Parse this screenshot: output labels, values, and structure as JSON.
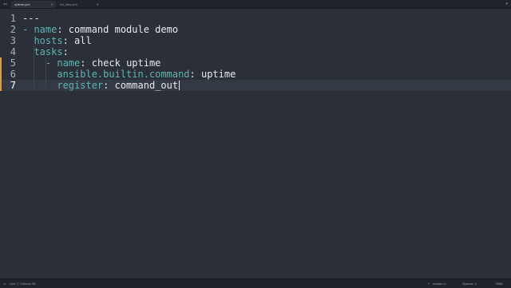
{
  "tabs": [
    {
      "label": "uptime.yml",
      "active": true
    },
    {
      "label": "list_files.yml",
      "active": false
    }
  ],
  "editor": {
    "current_line": 7,
    "lines": [
      {
        "number": "1",
        "content": [
          {
            "t": "---",
            "c": "plain"
          }
        ]
      },
      {
        "number": "2",
        "content": [
          {
            "t": "- ",
            "c": "dash"
          },
          {
            "t": "name",
            "c": "key"
          },
          {
            "t": ": command module demo",
            "c": "plain"
          }
        ]
      },
      {
        "number": "3",
        "content": [
          {
            "t": "  ",
            "c": "plain"
          },
          {
            "t": "hosts",
            "c": "key"
          },
          {
            "t": ": all",
            "c": "plain"
          }
        ]
      },
      {
        "number": "4",
        "content": [
          {
            "t": "  ",
            "c": "plain"
          },
          {
            "t": "tasks",
            "c": "key"
          },
          {
            "t": ":",
            "c": "plain"
          }
        ]
      },
      {
        "number": "5",
        "content": [
          {
            "t": "    ",
            "c": "plain"
          },
          {
            "t": "- ",
            "c": "dash"
          },
          {
            "t": "name",
            "c": "key"
          },
          {
            "t": ": check uptime",
            "c": "plain"
          }
        ]
      },
      {
        "number": "6",
        "content": [
          {
            "t": "      ",
            "c": "plain"
          },
          {
            "t": "ansible.builtin.command",
            "c": "key"
          },
          {
            "t": ": uptime",
            "c": "plain"
          }
        ]
      },
      {
        "number": "7",
        "content": [
          {
            "t": "      ",
            "c": "plain"
          },
          {
            "t": "register",
            "c": "key"
          },
          {
            "t": ": command_out",
            "c": "plain"
          }
        ]
      }
    ]
  },
  "status": {
    "position": "Line 7, Column 26",
    "branch": "master",
    "indentation": "Spaces: 2",
    "syntax": "YAML"
  },
  "colors": {
    "background": "#2b3038",
    "key": "#5fb4b4",
    "text": "#e6e9ed",
    "modified_marker": "#e39b3e"
  }
}
